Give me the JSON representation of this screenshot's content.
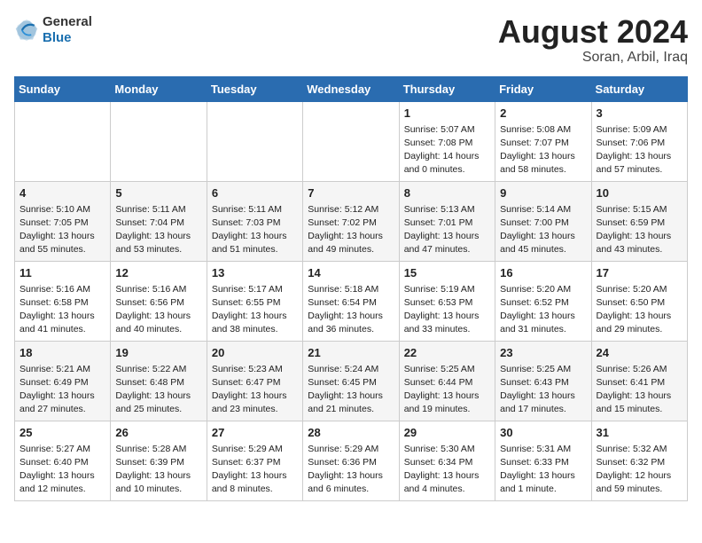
{
  "header": {
    "logo_general": "General",
    "logo_blue": "Blue",
    "month_year": "August 2024",
    "location": "Soran, Arbil, Iraq"
  },
  "days_of_week": [
    "Sunday",
    "Monday",
    "Tuesday",
    "Wednesday",
    "Thursday",
    "Friday",
    "Saturday"
  ],
  "weeks": [
    [
      {
        "day": "",
        "content": ""
      },
      {
        "day": "",
        "content": ""
      },
      {
        "day": "",
        "content": ""
      },
      {
        "day": "",
        "content": ""
      },
      {
        "day": "1",
        "content": "Sunrise: 5:07 AM\nSunset: 7:08 PM\nDaylight: 14 hours\nand 0 minutes."
      },
      {
        "day": "2",
        "content": "Sunrise: 5:08 AM\nSunset: 7:07 PM\nDaylight: 13 hours\nand 58 minutes."
      },
      {
        "day": "3",
        "content": "Sunrise: 5:09 AM\nSunset: 7:06 PM\nDaylight: 13 hours\nand 57 minutes."
      }
    ],
    [
      {
        "day": "4",
        "content": "Sunrise: 5:10 AM\nSunset: 7:05 PM\nDaylight: 13 hours\nand 55 minutes."
      },
      {
        "day": "5",
        "content": "Sunrise: 5:11 AM\nSunset: 7:04 PM\nDaylight: 13 hours\nand 53 minutes."
      },
      {
        "day": "6",
        "content": "Sunrise: 5:11 AM\nSunset: 7:03 PM\nDaylight: 13 hours\nand 51 minutes."
      },
      {
        "day": "7",
        "content": "Sunrise: 5:12 AM\nSunset: 7:02 PM\nDaylight: 13 hours\nand 49 minutes."
      },
      {
        "day": "8",
        "content": "Sunrise: 5:13 AM\nSunset: 7:01 PM\nDaylight: 13 hours\nand 47 minutes."
      },
      {
        "day": "9",
        "content": "Sunrise: 5:14 AM\nSunset: 7:00 PM\nDaylight: 13 hours\nand 45 minutes."
      },
      {
        "day": "10",
        "content": "Sunrise: 5:15 AM\nSunset: 6:59 PM\nDaylight: 13 hours\nand 43 minutes."
      }
    ],
    [
      {
        "day": "11",
        "content": "Sunrise: 5:16 AM\nSunset: 6:58 PM\nDaylight: 13 hours\nand 41 minutes."
      },
      {
        "day": "12",
        "content": "Sunrise: 5:16 AM\nSunset: 6:56 PM\nDaylight: 13 hours\nand 40 minutes."
      },
      {
        "day": "13",
        "content": "Sunrise: 5:17 AM\nSunset: 6:55 PM\nDaylight: 13 hours\nand 38 minutes."
      },
      {
        "day": "14",
        "content": "Sunrise: 5:18 AM\nSunset: 6:54 PM\nDaylight: 13 hours\nand 36 minutes."
      },
      {
        "day": "15",
        "content": "Sunrise: 5:19 AM\nSunset: 6:53 PM\nDaylight: 13 hours\nand 33 minutes."
      },
      {
        "day": "16",
        "content": "Sunrise: 5:20 AM\nSunset: 6:52 PM\nDaylight: 13 hours\nand 31 minutes."
      },
      {
        "day": "17",
        "content": "Sunrise: 5:20 AM\nSunset: 6:50 PM\nDaylight: 13 hours\nand 29 minutes."
      }
    ],
    [
      {
        "day": "18",
        "content": "Sunrise: 5:21 AM\nSunset: 6:49 PM\nDaylight: 13 hours\nand 27 minutes."
      },
      {
        "day": "19",
        "content": "Sunrise: 5:22 AM\nSunset: 6:48 PM\nDaylight: 13 hours\nand 25 minutes."
      },
      {
        "day": "20",
        "content": "Sunrise: 5:23 AM\nSunset: 6:47 PM\nDaylight: 13 hours\nand 23 minutes."
      },
      {
        "day": "21",
        "content": "Sunrise: 5:24 AM\nSunset: 6:45 PM\nDaylight: 13 hours\nand 21 minutes."
      },
      {
        "day": "22",
        "content": "Sunrise: 5:25 AM\nSunset: 6:44 PM\nDaylight: 13 hours\nand 19 minutes."
      },
      {
        "day": "23",
        "content": "Sunrise: 5:25 AM\nSunset: 6:43 PM\nDaylight: 13 hours\nand 17 minutes."
      },
      {
        "day": "24",
        "content": "Sunrise: 5:26 AM\nSunset: 6:41 PM\nDaylight: 13 hours\nand 15 minutes."
      }
    ],
    [
      {
        "day": "25",
        "content": "Sunrise: 5:27 AM\nSunset: 6:40 PM\nDaylight: 13 hours\nand 12 minutes."
      },
      {
        "day": "26",
        "content": "Sunrise: 5:28 AM\nSunset: 6:39 PM\nDaylight: 13 hours\nand 10 minutes."
      },
      {
        "day": "27",
        "content": "Sunrise: 5:29 AM\nSunset: 6:37 PM\nDaylight: 13 hours\nand 8 minutes."
      },
      {
        "day": "28",
        "content": "Sunrise: 5:29 AM\nSunset: 6:36 PM\nDaylight: 13 hours\nand 6 minutes."
      },
      {
        "day": "29",
        "content": "Sunrise: 5:30 AM\nSunset: 6:34 PM\nDaylight: 13 hours\nand 4 minutes."
      },
      {
        "day": "30",
        "content": "Sunrise: 5:31 AM\nSunset: 6:33 PM\nDaylight: 13 hours\nand 1 minute."
      },
      {
        "day": "31",
        "content": "Sunrise: 5:32 AM\nSunset: 6:32 PM\nDaylight: 12 hours\nand 59 minutes."
      }
    ]
  ]
}
